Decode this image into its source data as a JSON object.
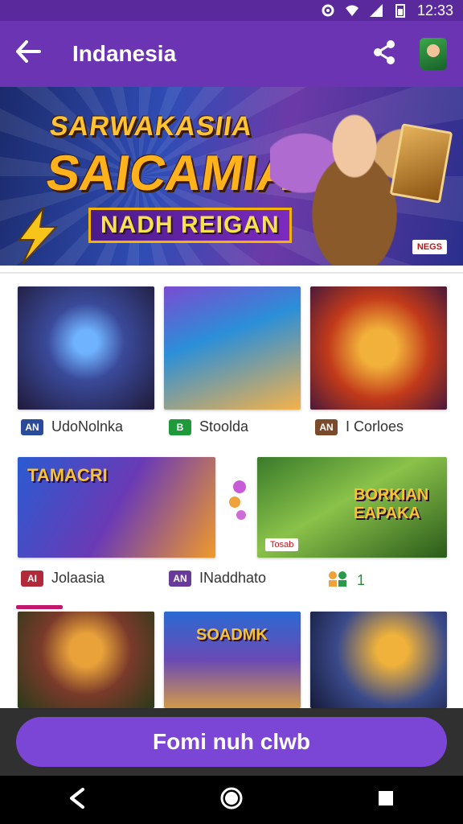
{
  "status_bar": {
    "time": "12:33"
  },
  "app_bar": {
    "title": "Indanesia",
    "back_icon": "back-arrow-icon",
    "share_icon": "share-icon",
    "avatar": "avatar"
  },
  "banner": {
    "line1": "SARWAKASIIA",
    "line2": "SAICAMIA",
    "line3": "NADH REIGAN",
    "badge": "NEGS"
  },
  "row1": [
    {
      "label": "UdoNolnka",
      "icon_text": "AN",
      "icon_color": "#2a4a9a"
    },
    {
      "label": "Stoolda",
      "icon_text": "B",
      "icon_color": "#1e9a3a"
    },
    {
      "label": "I Corloes",
      "icon_text": "AN",
      "icon_color": "#7a4a2a"
    }
  ],
  "row2": [
    {
      "label": "Jolaasia",
      "icon_text": "AI",
      "icon_color": "#b02a3a",
      "art_title": "TAMACRI"
    },
    {
      "label": "INaddhato",
      "icon_text": "AN",
      "icon_color": "#6a3a9a"
    },
    {
      "label": "1",
      "icon_text": "",
      "icon_color": "#e2a23a",
      "art_title": "BORKIAN EAPAKA",
      "art_chip": "Tosab"
    }
  ],
  "row3": [
    {
      "art_title": ""
    },
    {
      "art_title": "SOADMK"
    },
    {
      "art_title": ""
    }
  ],
  "cta": {
    "label": "Fomi nuh clwb"
  },
  "colors": {
    "app_bar": "#6b34b3",
    "status_bar": "#5a2a9c",
    "cta": "#7b45d6"
  }
}
